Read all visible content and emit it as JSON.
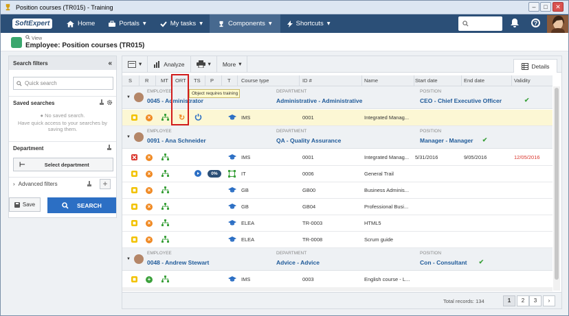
{
  "window": {
    "title": "Position courses (TR015) - Training"
  },
  "nav": {
    "logo": "SoftExpert",
    "items": [
      {
        "label": "Home",
        "icon": "home-icon",
        "arrow": ""
      },
      {
        "label": "Portals",
        "icon": "briefcase-icon",
        "arrow": "▾"
      },
      {
        "label": "My tasks",
        "icon": "check-icon",
        "arrow": "▾"
      },
      {
        "label": "Components",
        "icon": "trophy-icon",
        "arrow": "▾"
      },
      {
        "label": "Shortcuts",
        "icon": "bolt-icon",
        "arrow": "▾"
      }
    ]
  },
  "crumb": {
    "small": "View",
    "title": "Employee: Position courses (TR015)"
  },
  "left": {
    "title": "Search filters",
    "quick_search_placeholder": "Quick search",
    "saved_searches": "Saved searches",
    "no_saved": "No saved search.",
    "no_saved_hint": "Have quick access to your searches by saving them.",
    "department": "Department",
    "select_department": "Select department",
    "advanced_filters": "Advanced filters",
    "save": "Save",
    "search": "SEARCH"
  },
  "toolbar": {
    "analyze": "Analyze",
    "more": "More",
    "details": "Details"
  },
  "columns": [
    "S",
    "R",
    "MT",
    "ORT",
    "TS",
    "P",
    "T",
    "Course type",
    "ID #",
    "Name",
    "Start date",
    "End date",
    "Validity"
  ],
  "tooltip": "Object requires training",
  "employees": [
    {
      "label": "EMPLOYEE",
      "name": "0045 - Administrator",
      "dept_label": "DEPARTMENT",
      "dept": "Administrative - Administrative",
      "pos_label": "POSITION",
      "pos": "CEO - Chief Executive Officer",
      "rows": [
        {
          "s": "yellow",
          "r": "orange",
          "ort": true,
          "ts": "power",
          "p": "",
          "course": "IMS",
          "id": "0001",
          "name": "Integrated Manag...",
          "start": "",
          "end": "",
          "validity": "",
          "sel": true
        }
      ]
    },
    {
      "label": "EMPLOYEE",
      "name": "0091 - Ana Schneider",
      "dept_label": "DEPARTMENT",
      "dept": "QA - Quality Assurance",
      "pos_label": "POSITION",
      "pos": "Manager - Manager",
      "rows": [
        {
          "s": "red",
          "r": "orange",
          "ts": "",
          "p": "",
          "course": "IMS",
          "id": "0001",
          "name": "Integrated Manag...",
          "start": "5/31/2016",
          "end": "9/05/2016",
          "validity": "12/05/2016"
        },
        {
          "s": "yellow",
          "r": "orange",
          "ts": "play",
          "p": "0%",
          "course": "IT",
          "id": "0006",
          "name": "General Trail",
          "start": "",
          "end": "",
          "validity": ""
        },
        {
          "s": "yellow",
          "r": "orange",
          "ts": "",
          "p": "",
          "course": "GB",
          "id": "GB00",
          "name": "Business Adminis...",
          "start": "",
          "end": "",
          "validity": ""
        },
        {
          "s": "yellow",
          "r": "orange",
          "ts": "",
          "p": "",
          "course": "GB",
          "id": "GB04",
          "name": "Professional Busi...",
          "start": "",
          "end": "",
          "validity": ""
        },
        {
          "s": "yellow",
          "r": "orange",
          "ts": "",
          "p": "",
          "course": "ELEA",
          "id": "TR-0003",
          "name": "HTML5",
          "start": "",
          "end": "",
          "validity": ""
        },
        {
          "s": "yellow",
          "r": "orange",
          "ts": "",
          "p": "",
          "course": "ELEA",
          "id": "TR-0008",
          "name": "Scrum guide",
          "start": "",
          "end": "",
          "validity": ""
        }
      ]
    },
    {
      "label": "EMPLOYEE",
      "name": "0048 - Andrew Stewart",
      "dept_label": "DEPARTMENT",
      "dept": "Advice - Advice",
      "pos_label": "POSITION",
      "pos": "Con - Consultant",
      "rows": [
        {
          "s": "yellow",
          "r": "green",
          "ts": "",
          "p": "",
          "course": "IMS",
          "id": "0003",
          "name": "English course - L...",
          "start": "",
          "end": "",
          "validity": ""
        }
      ]
    }
  ],
  "footer": {
    "total": "Total records: 134",
    "pages": [
      "1",
      "2",
      "3"
    ],
    "next": "›"
  },
  "colors": {
    "nav": "#2b4f77",
    "accent": "#2c6fc4",
    "link": "#1f5a99",
    "red": "#d9342b",
    "yellow": "#f2c200",
    "orange": "#f08a24",
    "green": "#3ca13c"
  }
}
